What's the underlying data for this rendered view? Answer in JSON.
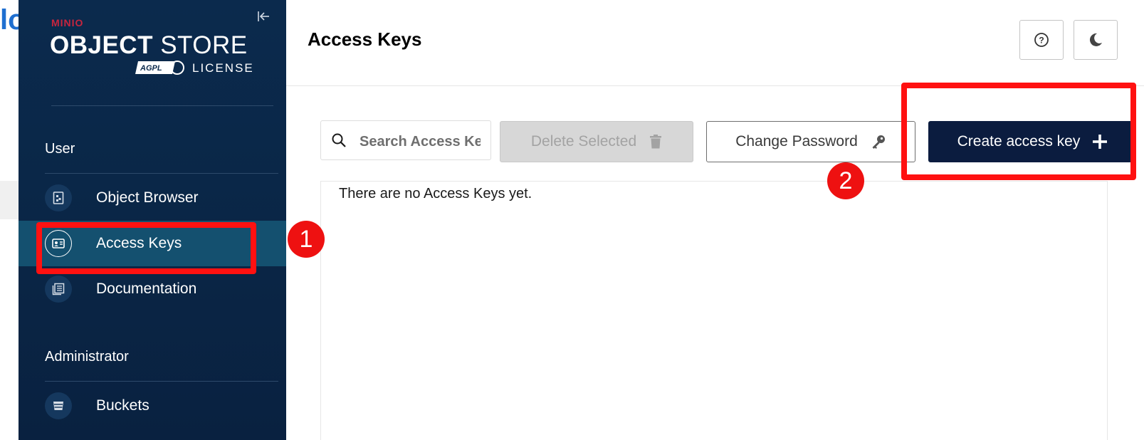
{
  "background_app": {
    "partial_letter": "lo"
  },
  "sidebar": {
    "brand": {
      "small": "MINIO",
      "big_bold": "OBJECT",
      "big_light": " STORE",
      "badge": "AGPL",
      "license": "LICENSE"
    },
    "sections": [
      {
        "title": "User",
        "items": [
          {
            "label": "Object Browser",
            "icon": "object-browser-icon",
            "active": false
          },
          {
            "label": "Access Keys",
            "icon": "access-keys-icon",
            "active": true
          },
          {
            "label": "Documentation",
            "icon": "documentation-icon",
            "active": false
          }
        ]
      },
      {
        "title": "Administrator",
        "items": [
          {
            "label": "Buckets",
            "icon": "buckets-icon",
            "active": false
          }
        ]
      }
    ]
  },
  "header": {
    "title": "Access Keys",
    "help_icon": "help-icon",
    "theme_icon": "dark-mode-moon-icon"
  },
  "toolbar": {
    "search_placeholder": "Search Access Keys",
    "delete_label": "Delete Selected",
    "change_password_label": "Change Password",
    "create_label": "Create access key"
  },
  "content": {
    "empty_message": "There are no Access Keys yet."
  },
  "annotations": {
    "badge1": "1",
    "badge2": "2",
    "highlight_color": "#ff1111"
  },
  "colors": {
    "sidebar_bg": "#0b2a4d",
    "active_item": "#14506f",
    "primary_button": "#0b1c3f"
  }
}
